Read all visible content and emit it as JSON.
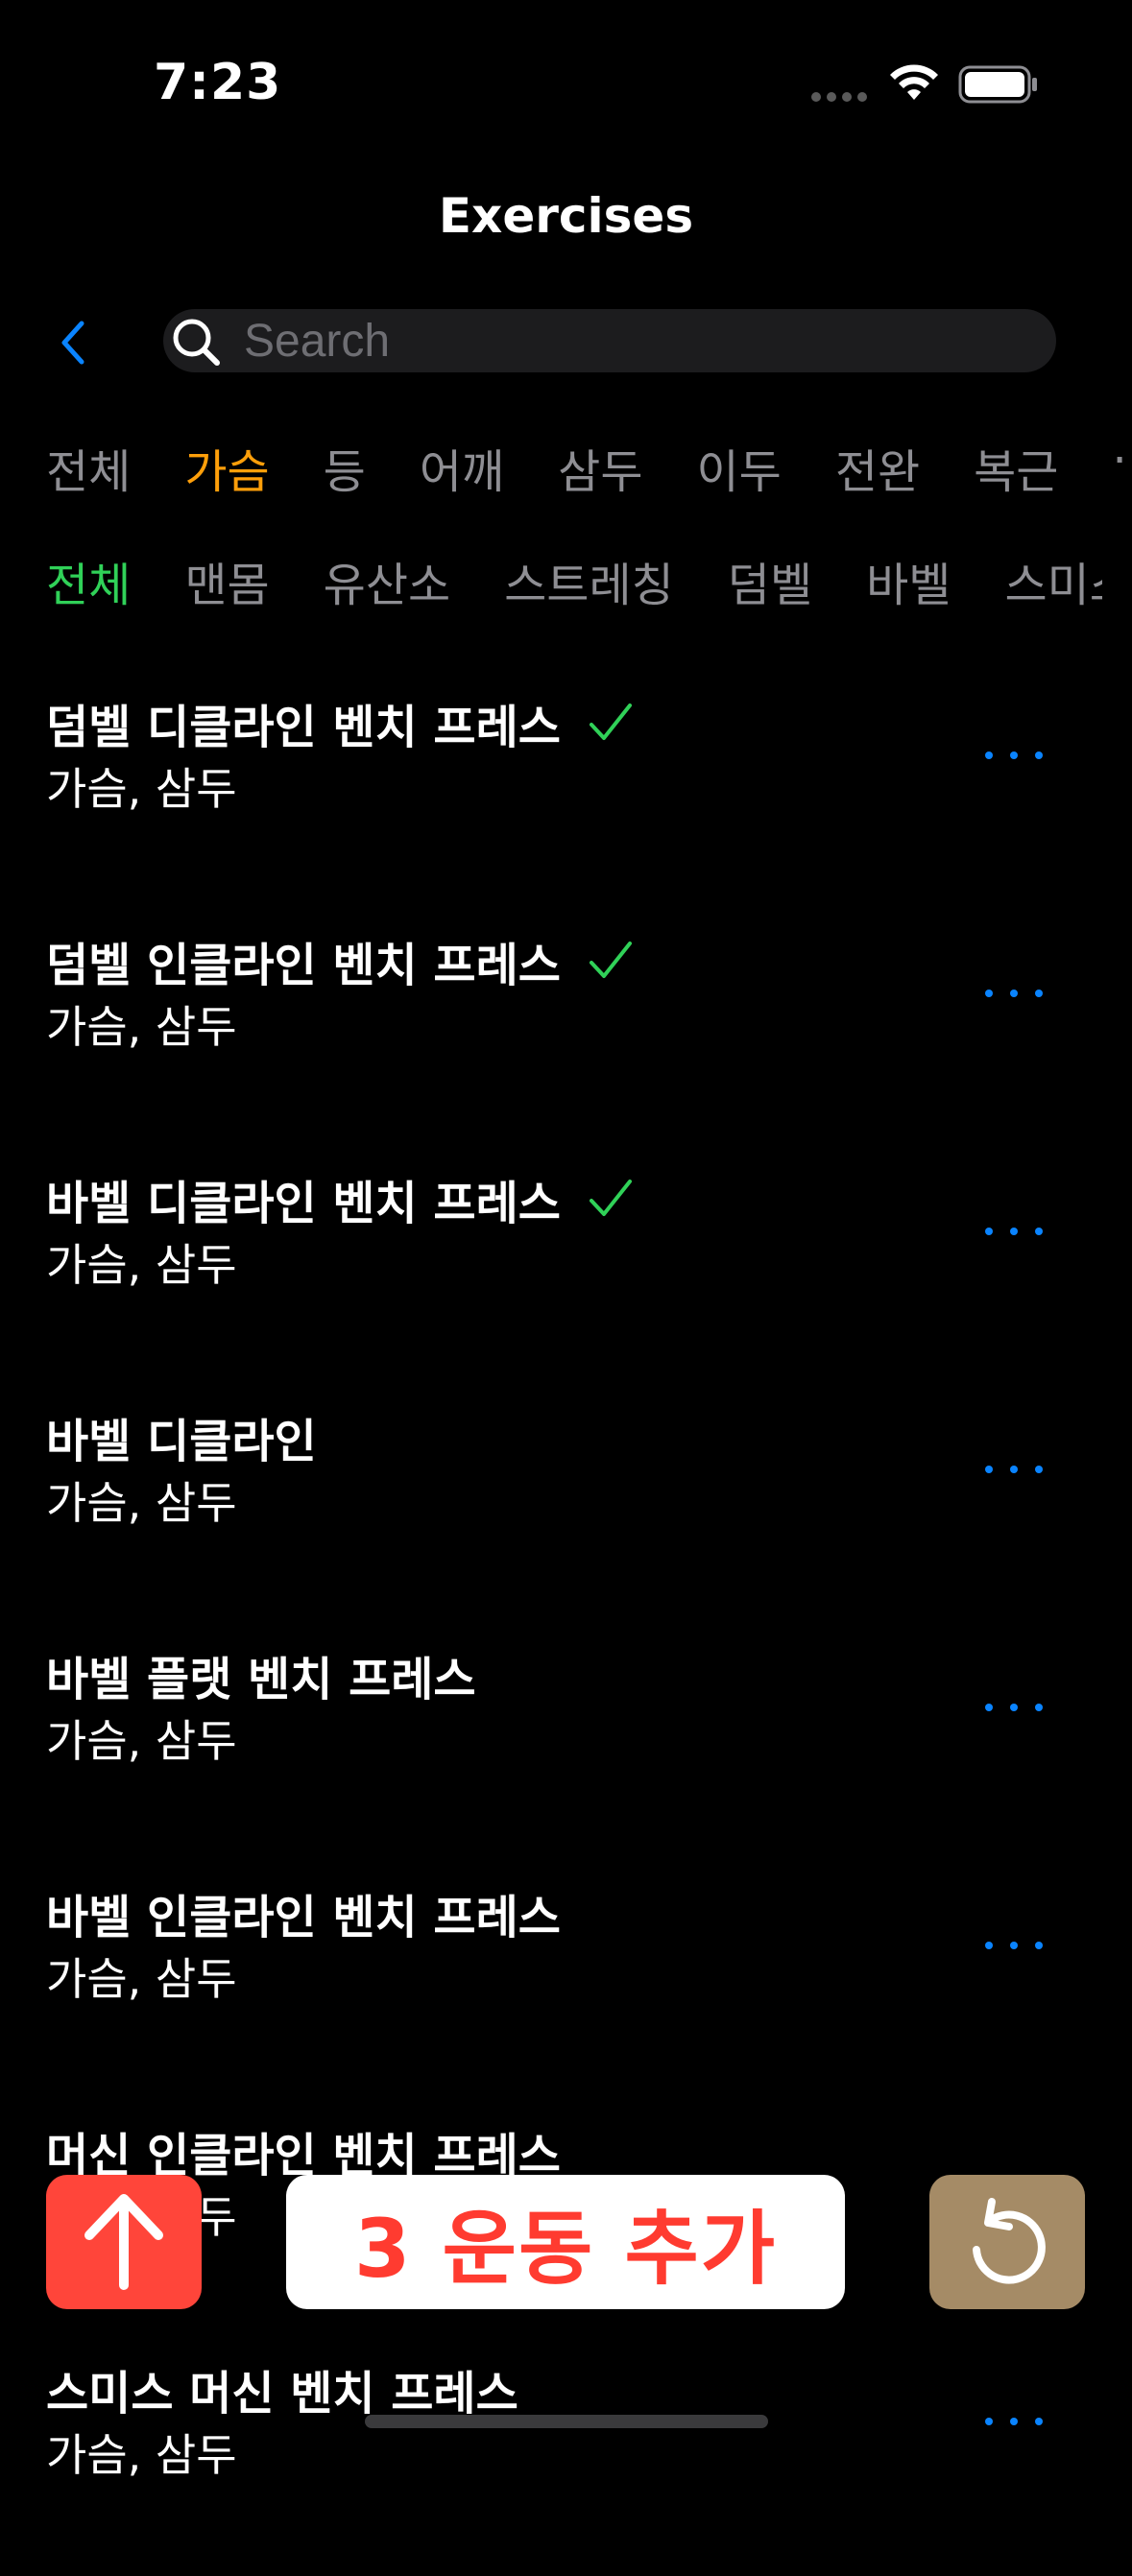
{
  "status_bar": {
    "time": "7:23"
  },
  "nav": {
    "title": "Exercises",
    "search_placeholder": "Search"
  },
  "muscle_filters": [
    "전체",
    "가슴",
    "등",
    "어깨",
    "삼두",
    "이두",
    "전완",
    "복근"
  ],
  "muscle_filter_selected": "가슴",
  "equipment_filters": [
    "전체",
    "맨몸",
    "유산소",
    "스트레칭",
    "덤벨",
    "바벨",
    "스미스"
  ],
  "equipment_filter_selected": "전체",
  "exercises": [
    {
      "name": "덤벨 디클라인 벤치 프레스",
      "muscles": "가슴, 삼두",
      "checked": true
    },
    {
      "name": "덤벨 인클라인 벤치 프레스",
      "muscles": "가슴, 삼두",
      "checked": true
    },
    {
      "name": "바벨 디클라인 벤치 프레스",
      "muscles": "가슴, 삼두",
      "checked": true
    },
    {
      "name": "바벨 디클라인",
      "muscles": "가슴, 삼두",
      "checked": false
    },
    {
      "name": "바벨 플랫 벤치 프레스",
      "muscles": "가슴, 삼두",
      "checked": false
    },
    {
      "name": "바벨 인클라인 벤치 프레스",
      "muscles": "가슴, 삼두",
      "checked": false
    },
    {
      "name": "머신 인클라인 벤치 프레스",
      "muscles": "가슴, 삼두",
      "checked": false
    },
    {
      "name": "스미스 머신 벤치 프레스",
      "muscles": "가슴, 삼두",
      "checked": false
    }
  ],
  "bottom_bar": {
    "add_label": "3 운동 추가"
  },
  "colors": {
    "accent_blue": "#0a84ff",
    "active_orange": "#ff9f0a",
    "active_green": "#30d158",
    "add_text_red": "#ff3b30",
    "scroll_top_red": "#ff453a",
    "reset_tan": "#a58b66"
  },
  "icons": {
    "back": "chevron-left-icon",
    "search": "search-icon",
    "checked": "checkmark-icon",
    "more": "ellipsis-icon",
    "scroll_top": "arrow-up-icon",
    "reset": "rotate-ccw-icon"
  }
}
